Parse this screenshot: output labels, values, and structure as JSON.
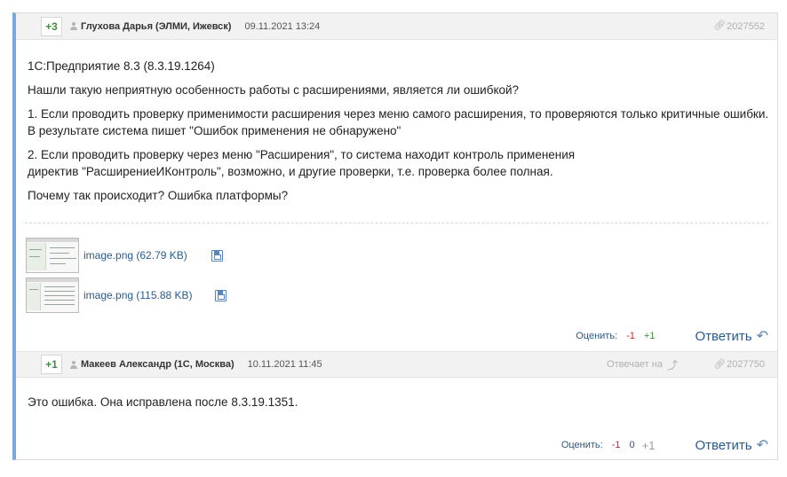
{
  "posts": [
    {
      "score": "+3",
      "author": "Глухова Дарья (ЭЛМИ, Ижевск)",
      "date": "09.11.2021 13:24",
      "id": "2027552",
      "paragraphs": [
        "1С:Предприятие 8.3 (8.3.19.1264)",
        "Нашли такую неприятную особенность работы с расширениями, является ли ошибкой?",
        "1. Если проводить проверку применимости расширения через меню самого расширения, то проверяются только критичные ошибки. В результате система пишет \"Ошибок применения не обнаружено\"",
        "2. Если проводить проверку через меню \"Расширения\", то система находит контроль применения директив \"РасширениеИКонтроль\", возможно, и другие проверки, т.е. проверка более полная.",
        "Почему так происходит? Ошибка платформы?"
      ],
      "attachments": [
        {
          "name": "image.png",
          "size": "(62.79 KB)"
        },
        {
          "name": "image.png",
          "size": "(115.88 KB)"
        }
      ],
      "rate_label": "Оценить:",
      "rate_minus": "-1",
      "rate_plus": "+1",
      "reply_label": "Ответить"
    },
    {
      "score": "+1",
      "author": "Макеев Александр (1С, Москва)",
      "date": "10.11.2021 11:45",
      "reply_to_label": "Отвечает на",
      "id": "2027750",
      "paragraphs": [
        "Это ошибка. Она исправлена после 8.3.19.1351."
      ],
      "rate_label": "Оценить:",
      "rate_minus": "-1",
      "rate_zero": "0",
      "rate_plus": "+1",
      "reply_label": "Ответить"
    }
  ],
  "colors": {
    "accent_border": "#7aa7e0",
    "link": "#2a5a8a",
    "positive": "#3f8f3f",
    "negative": "#cc2222"
  },
  "icons": {
    "user": "user-icon",
    "id_link": "paperclip-icon",
    "save": "save-icon",
    "reply": "reply-arrow-icon",
    "reply_to": "up-arrow-icon"
  }
}
